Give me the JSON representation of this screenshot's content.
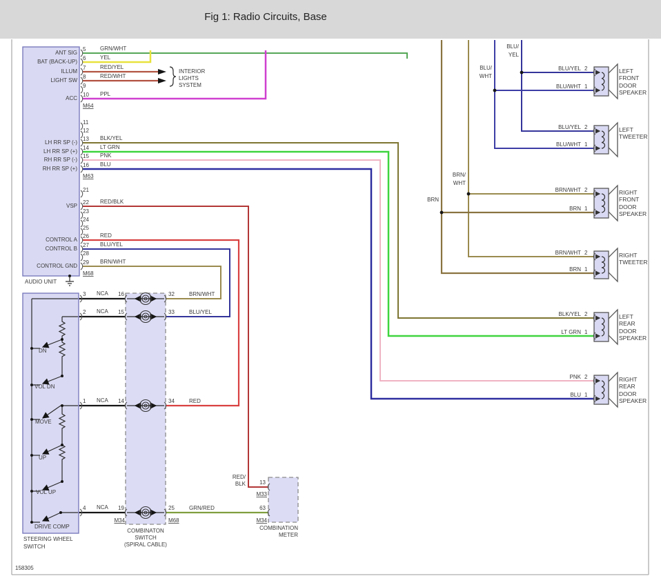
{
  "header": {
    "title": "Fig 1: Radio Circuits, Base"
  },
  "figure_number": "158305",
  "colors": {
    "grn_wht": "#55a757",
    "yel": "#e8e23c",
    "red_yel": "#b25440",
    "red_wht": "#b25040",
    "ppl": "#cf3fcf",
    "blk_yel": "#7d7532",
    "lt_grn": "#3ed43e",
    "pnk": "#f0b3c3",
    "blu": "#2d2da0",
    "red_blk": "#b23636",
    "red": "#d94040",
    "blu_yel": "#34349b",
    "brn_wht": "#9a8a4e",
    "brn": "#8a7340",
    "nca": "#151515",
    "grn_red": "#7f9e3e",
    "blu_wht": "#3c3ca6"
  },
  "audio_unit": {
    "name": "AUDIO UNIT",
    "connectors": {
      "c1": "M64",
      "c2": "M63",
      "c3": "M68"
    },
    "interior_lights": [
      "INTERIOR",
      "LIGHTS",
      "SYSTEM"
    ],
    "pins": [
      {
        "num": "5",
        "name": "ANT SIG",
        "wire": "GRN/WHT"
      },
      {
        "num": "6",
        "name": "BAT (BACK-UP)",
        "wire": "YEL"
      },
      {
        "num": "7",
        "name": "ILLUM",
        "wire": "RED/YEL"
      },
      {
        "num": "8",
        "name": "LIGHT SW",
        "wire": "RED/WHT"
      },
      {
        "num": "9",
        "name": "",
        "wire": ""
      },
      {
        "num": "10",
        "name": "ACC",
        "wire": "PPL"
      },
      {
        "num": "11",
        "name": "",
        "wire": ""
      },
      {
        "num": "12",
        "name": "",
        "wire": ""
      },
      {
        "num": "13",
        "name": "LH RR SP (-)",
        "wire": "BLK/YEL"
      },
      {
        "num": "14",
        "name": "LH RR SP (+)",
        "wire": "LT GRN"
      },
      {
        "num": "15",
        "name": "RH RR SP (-)",
        "wire": "PNK"
      },
      {
        "num": "16",
        "name": "RH RR SP (+)",
        "wire": "BLU"
      },
      {
        "num": "21",
        "name": "",
        "wire": ""
      },
      {
        "num": "22",
        "name": "VSP",
        "wire": "RED/BLK"
      },
      {
        "num": "23",
        "name": "",
        "wire": ""
      },
      {
        "num": "24",
        "name": "",
        "wire": ""
      },
      {
        "num": "25",
        "name": "",
        "wire": ""
      },
      {
        "num": "26",
        "name": "CONTROL A",
        "wire": "RED"
      },
      {
        "num": "27",
        "name": "CONTROL B",
        "wire": "BLU/YEL"
      },
      {
        "num": "28",
        "name": "",
        "wire": ""
      },
      {
        "num": "29",
        "name": "CONTROL GND",
        "wire": "BRN/WHT"
      }
    ]
  },
  "steering": {
    "name_lines": [
      "STEERING WHEEL",
      "SWITCH"
    ],
    "switches": [
      "DN",
      "VOL DN",
      "MOVE",
      "UP",
      "VOL UP",
      "DRIVE COMP"
    ],
    "pins": [
      "3",
      "2",
      "1",
      "4"
    ],
    "wires": [
      "NCA",
      "NCA",
      "NCA",
      "NCA"
    ]
  },
  "spiral": {
    "name_lines": [
      "COMBINATON",
      "SWITCH",
      "(SPIRAL CABLE)"
    ],
    "left_pins": [
      "16",
      "15",
      "14",
      "19"
    ],
    "right_pins": [
      "32",
      "33",
      "34",
      "25"
    ],
    "right_wires": [
      "BRN/WHT",
      "BLU/YEL",
      "RED",
      "GRN/RED"
    ],
    "left_connector": "M34",
    "right_connector": "M68"
  },
  "meter": {
    "name_lines": [
      "COMBINATION",
      "METER"
    ],
    "pin_top": "13",
    "pin_bottom": "63",
    "connector_top": "M33",
    "connector_bottom": "M34",
    "wire_in_lines": [
      "RED/",
      "BLK"
    ]
  },
  "right_bus": {
    "blu_yel_lines": [
      "BLU/",
      "YEL"
    ],
    "blu_wht_lines": [
      "BLU/",
      "WHT"
    ],
    "brn_wht_lines": [
      "BRN/",
      "WHT"
    ],
    "brn": "BRN"
  },
  "speakers": [
    {
      "name_lines": [
        "LEFT",
        "FRONT",
        "DOOR",
        "SPEAKER"
      ],
      "pin2": "2",
      "pin1": "1",
      "wire2": "BLU/YEL",
      "wire1": "BLU/WHT"
    },
    {
      "name_lines": [
        "LEFT",
        "TWEETER"
      ],
      "pin2": "2",
      "pin1": "1",
      "wire2": "BLU/YEL",
      "wire1": "BLU/WHT"
    },
    {
      "name_lines": [
        "RIGHT",
        "FRONT",
        "DOOR",
        "SPEAKER"
      ],
      "pin2": "2",
      "pin1": "1",
      "wire2": "BRN/WHT",
      "wire1": "BRN"
    },
    {
      "name_lines": [
        "RIGHT",
        "TWEETER"
      ],
      "pin2": "2",
      "pin1": "1",
      "wire2": "BRN/WHT",
      "wire1": "BRN"
    },
    {
      "name_lines": [
        "LEFT",
        "REAR",
        "DOOR",
        "SPEAKER"
      ],
      "pin2": "2",
      "pin1": "1",
      "wire2": "BLK/YEL",
      "wire1": "LT GRN"
    },
    {
      "name_lines": [
        "RIGHT",
        "REAR",
        "DOOR",
        "SPEAKER"
      ],
      "pin2": "2",
      "pin1": "1",
      "wire2": "PNK",
      "wire1": "BLU"
    }
  ]
}
